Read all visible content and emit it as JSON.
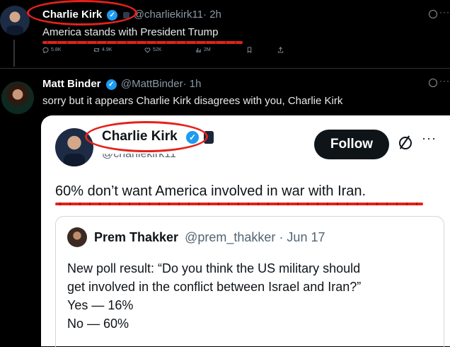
{
  "tweet1": {
    "name": "Charlie Kirk",
    "handle": "@charliekirk11",
    "time": "· 2h",
    "text": "America stands with President Trump",
    "stats": {
      "replies": "5.8K",
      "reposts": "4.9K",
      "likes": "52K",
      "views": "2M"
    }
  },
  "tweet2": {
    "name": "Matt Binder",
    "handle": "@MattBinder",
    "time": "· 1h",
    "text": "sorry but it appears Charlie Kirk disagrees with you, Charlie Kirk"
  },
  "embed": {
    "name": "Charlie Kirk",
    "handle": "@charliekirk11",
    "follow_label": "Follow",
    "text": "60% don’t want America involved in war with Iran.",
    "quote": {
      "name": "Prem Thakker",
      "handle": "@prem_thakker",
      "time": "· Jun 17",
      "line1": "New poll result: “Do you think the US military should",
      "line2": "get involved in the conflict between Israel and Iran?”",
      "line3": "Yes — 16%",
      "line4": "No — 60%"
    }
  },
  "icons": [
    "verified-icon",
    "reply-icon",
    "repost-icon",
    "like-icon",
    "views-icon",
    "bookmark-icon",
    "share-icon",
    "grok-icon",
    "more-icon"
  ],
  "colors": {
    "annotation_red": "#e4221b",
    "verified_blue": "#1d9bf0",
    "dark_bg": "#000000"
  }
}
